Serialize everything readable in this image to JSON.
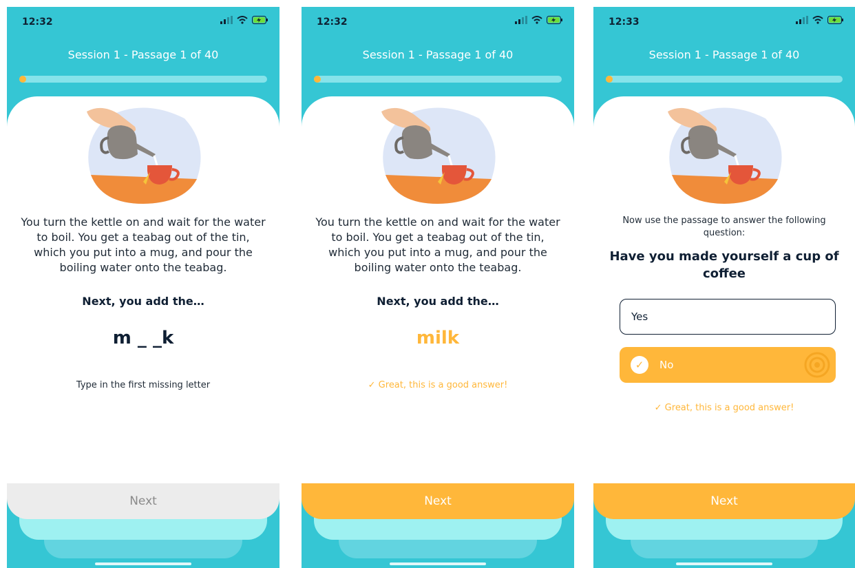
{
  "colors": {
    "header_bg": "#35c6d4",
    "accent": "#ffb73a",
    "text_dark": "#0f1f33",
    "progress_track": "#86e3ea",
    "next_disabled_bg": "#ececec"
  },
  "screens": [
    {
      "status_time": "12:32",
      "session_title": "Session 1 - Passage 1 of 40",
      "progress": 0.02,
      "passage": "You turn the kettle on and wait for the water to boil. You get a teabag out of the tin, which you put into a mug, and pour the boiling water onto the teabag.",
      "prompt": "Next, you add the…",
      "word": "m _ _k",
      "hint": "Type in the first missing letter",
      "next_label": "Next",
      "next_state": "disabled"
    },
    {
      "status_time": "12:32",
      "session_title": "Session 1 - Passage 1 of 40",
      "progress": 0.02,
      "passage": "You turn the kettle on and wait for the water to boil. You get a teabag out of the tin, which you put into a mug, and pour the boiling water onto the teabag.",
      "prompt": "Next, you add the…",
      "word": "milk",
      "feedback": "✓ Great, this is a good answer!",
      "next_label": "Next",
      "next_state": "active"
    },
    {
      "status_time": "12:33",
      "session_title": "Session 1 - Passage 1 of 40",
      "progress": 0.02,
      "question_intro": "Now use the passage to answer the following question:",
      "question": "Have you made yourself a cup of coffee",
      "options": [
        {
          "label": "Yes",
          "selected": false
        },
        {
          "label": "No",
          "selected": true
        }
      ],
      "feedback": "✓ Great, this is a good answer!",
      "next_label": "Next",
      "next_state": "active"
    }
  ]
}
